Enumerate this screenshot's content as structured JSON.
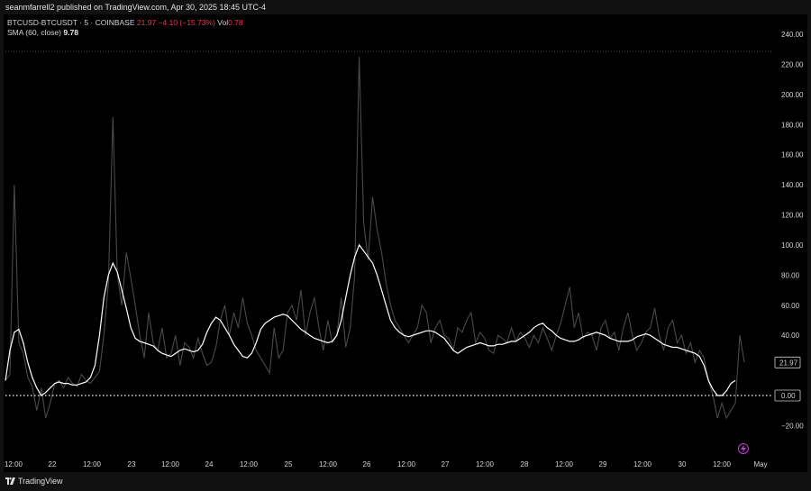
{
  "header": {
    "published": "seanmfarrell2 published on TradingView.com, Apr 30, 2025 18:45 UTC-4"
  },
  "legend": {
    "symbol": "BTCUSD-BTCUSDT · 5 · COINBASE",
    "last": "21.97",
    "change": "−4.10 (−15.73%)",
    "vol_label": "Vol",
    "vol_value": "0.78",
    "sma_label": "SMA (60, close)",
    "sma_value": "9.78"
  },
  "footer": {
    "logo_text": "TradingView"
  },
  "colors": {
    "background": "#000000",
    "price_line": "#4a4a4a",
    "sma_line": "#ffffff",
    "zero_line": "#ffffff"
  },
  "icons": {
    "logo": "tradingview-logo-icon",
    "replay": "lightning-icon"
  },
  "chart_data": {
    "type": "line",
    "y_ticks": [
      240,
      220,
      200,
      180,
      160,
      140,
      120,
      100,
      80,
      60,
      40,
      20,
      0,
      -20
    ],
    "y_tick_labels": [
      "240.00",
      "220.00",
      "200.00",
      "180.00",
      "160.00",
      "140.00",
      "120.00",
      "100.00",
      "80.00",
      "60.00",
      "40.00",
      "20.00",
      "0.00",
      "−20.00"
    ],
    "ylim": [
      -30,
      245
    ],
    "x_labels": [
      "12:00",
      "22",
      "12:00",
      "23",
      "12:00",
      "24",
      "12:00",
      "25",
      "12:00",
      "26",
      "12:00",
      "27",
      "12:00",
      "28",
      "12:00",
      "29",
      "12:00",
      "30",
      "12:00",
      "May"
    ],
    "last_price_label": "21.97",
    "zero_label": "0.00",
    "series": [
      {
        "values": [
          10,
          14,
          140,
          35,
          28,
          12,
          6,
          -10,
          5,
          -15,
          -5,
          8,
          10,
          5,
          12,
          8,
          6,
          14,
          10,
          8,
          12,
          16,
          40,
          75,
          185,
          80,
          60,
          95,
          78,
          60,
          40,
          25,
          55,
          35,
          30,
          45,
          25,
          28,
          40,
          20,
          35,
          32,
          25,
          38,
          28,
          20,
          22,
          32,
          50,
          60,
          40,
          55,
          45,
          65,
          48,
          40,
          30,
          25,
          20,
          15,
          45,
          25,
          30,
          55,
          60,
          50,
          70,
          40,
          55,
          65,
          45,
          30,
          50,
          35,
          40,
          65,
          32,
          45,
          80,
          225,
          115,
          90,
          132,
          110,
          95,
          75,
          60,
          50,
          45,
          40,
          35,
          40,
          45,
          60,
          55,
          35,
          45,
          50,
          40,
          38,
          30,
          45,
          42,
          50,
          55,
          35,
          42,
          38,
          30,
          28,
          40,
          38,
          35,
          45,
          36,
          42,
          38,
          32,
          40,
          35,
          45,
          38,
          30,
          40,
          48,
          60,
          72,
          45,
          55,
          38,
          42,
          40,
          30,
          45,
          50,
          38,
          42,
          30,
          45,
          55,
          40,
          30,
          35,
          42,
          45,
          58,
          40,
          30,
          45,
          50,
          35,
          40,
          28,
          35,
          22,
          30,
          25,
          10,
          0,
          -15,
          -5,
          -15,
          -10,
          -5,
          40,
          22
        ],
        "sma": [
          10,
          30,
          42,
          44,
          35,
          22,
          12,
          5,
          0,
          2,
          5,
          8,
          9,
          8,
          8,
          7,
          7,
          8,
          9,
          12,
          20,
          40,
          65,
          80,
          88,
          82,
          70,
          58,
          45,
          38,
          36,
          35,
          34,
          33,
          30,
          28,
          27,
          26,
          28,
          30,
          31,
          30,
          29,
          30,
          34,
          42,
          48,
          52,
          50,
          45,
          40,
          34,
          30,
          26,
          25,
          28,
          35,
          44,
          48,
          50,
          52,
          53,
          54,
          53,
          50,
          47,
          44,
          42,
          40,
          38,
          37,
          36,
          35,
          36,
          40,
          50,
          65,
          80,
          92,
          100,
          96,
          92,
          88,
          80,
          70,
          60,
          50,
          45,
          42,
          40,
          39,
          40,
          41,
          42,
          43,
          43,
          42,
          40,
          38,
          34,
          30,
          28,
          30,
          32,
          33,
          34,
          35,
          34,
          33,
          33,
          34,
          34,
          35,
          36,
          36,
          38,
          40,
          42,
          45,
          47,
          48,
          45,
          43,
          40,
          38,
          37,
          36,
          36,
          37,
          39,
          40,
          41,
          42,
          41,
          40,
          38,
          37,
          36,
          36,
          36,
          37,
          39,
          40,
          41,
          40,
          38,
          36,
          34,
          33,
          32,
          32,
          31,
          30,
          29,
          28,
          26,
          20,
          10,
          4,
          0,
          0,
          3,
          8,
          10
        ],
        "last": 21.97
      }
    ]
  }
}
